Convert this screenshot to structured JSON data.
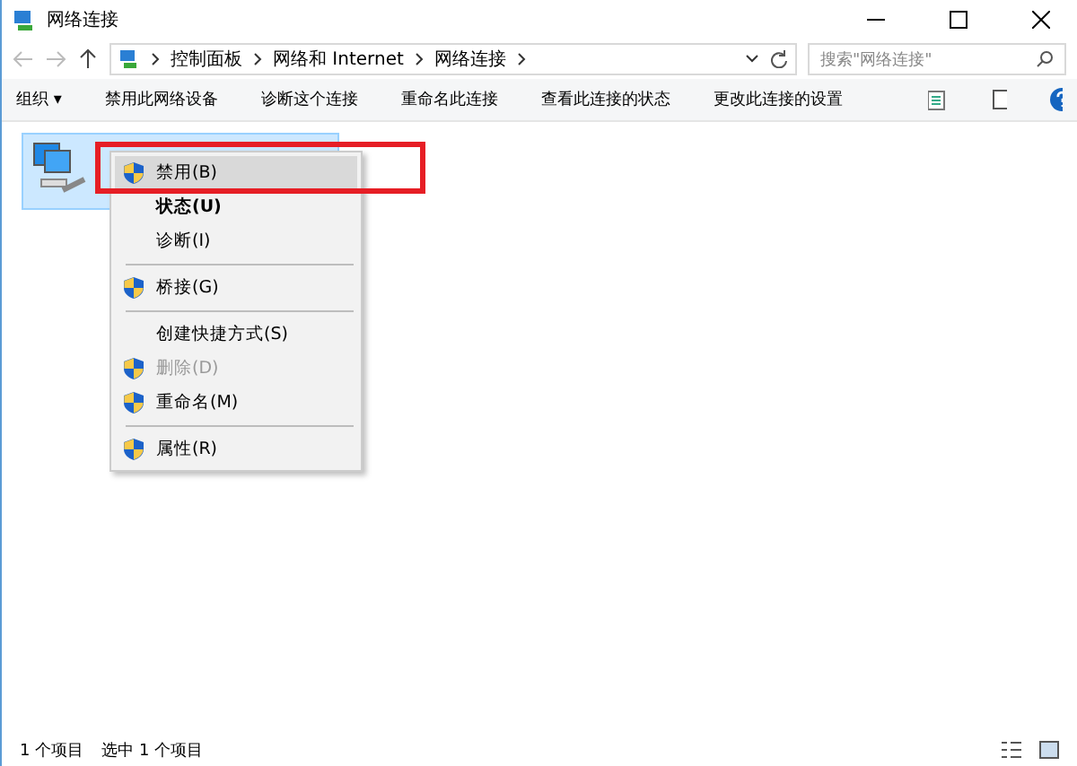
{
  "window": {
    "title": "网络连接"
  },
  "address": {
    "path": [
      "控制面板",
      "网络和 Internet",
      "网络连接"
    ]
  },
  "search": {
    "placeholder": "搜索\"网络连接\""
  },
  "toolbar": {
    "items": [
      "组织 ▾",
      "禁用此网络设备",
      "诊断这个连接",
      "重命名此连接",
      "查看此连接的状态",
      "更改此连接的设置"
    ]
  },
  "items": [
    {
      "selected": true
    }
  ],
  "context_menu": {
    "items": [
      {
        "kind": "item",
        "label": "禁用(B)",
        "shield": true,
        "bold": false,
        "disabled": false,
        "selected": true
      },
      {
        "kind": "item",
        "label": "状态(U)",
        "shield": false,
        "bold": true,
        "disabled": false,
        "selected": false
      },
      {
        "kind": "item",
        "label": "诊断(I)",
        "shield": false,
        "bold": false,
        "disabled": false,
        "selected": false
      },
      {
        "kind": "separator"
      },
      {
        "kind": "item",
        "label": "桥接(G)",
        "shield": true,
        "bold": false,
        "disabled": false,
        "selected": false
      },
      {
        "kind": "separator"
      },
      {
        "kind": "item",
        "label": "创建快捷方式(S)",
        "shield": false,
        "bold": false,
        "disabled": false,
        "selected": false
      },
      {
        "kind": "item",
        "label": "删除(D)",
        "shield": true,
        "bold": false,
        "disabled": true,
        "selected": false
      },
      {
        "kind": "item",
        "label": "重命名(M)",
        "shield": true,
        "bold": false,
        "disabled": false,
        "selected": false
      },
      {
        "kind": "separator"
      },
      {
        "kind": "item",
        "label": "属性(R)",
        "shield": true,
        "bold": false,
        "disabled": false,
        "selected": false
      }
    ]
  },
  "status_bar": {
    "items": [
      "1 个项目",
      "选中 1 个项目"
    ]
  }
}
